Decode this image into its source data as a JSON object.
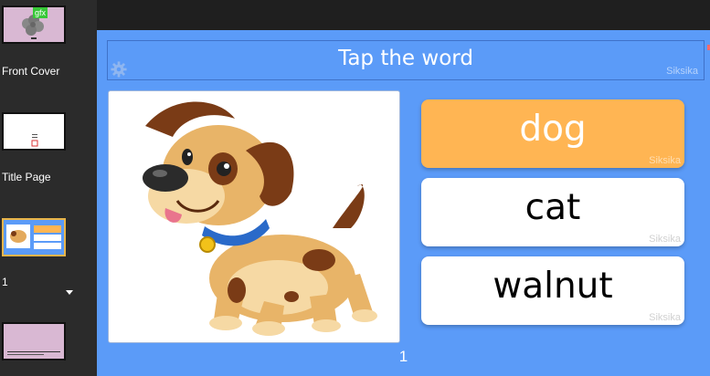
{
  "sidebar": {
    "items": [
      {
        "label": "Front Cover",
        "badge": "gfx"
      },
      {
        "label": "Title Page"
      },
      {
        "label": "1"
      },
      {
        "label": ""
      }
    ]
  },
  "page": {
    "title": "Tap the word",
    "watermark": "Siksika",
    "choices": [
      {
        "word": "dog",
        "color": "#ffb553",
        "text_color": "#ffffff",
        "watermark": "Siksika"
      },
      {
        "word": "cat",
        "color": "#ffffff",
        "text_color": "#000000",
        "watermark": "Siksika"
      },
      {
        "word": "walnut",
        "color": "#ffffff",
        "text_color": "#000000",
        "watermark": "Siksika"
      }
    ],
    "page_number": "1",
    "image": "cartoon-puppy"
  },
  "colors": {
    "page_background": "#5b9bf8",
    "selected_choice": "#ffb553",
    "active_thumb_border": "#e8b54a"
  }
}
